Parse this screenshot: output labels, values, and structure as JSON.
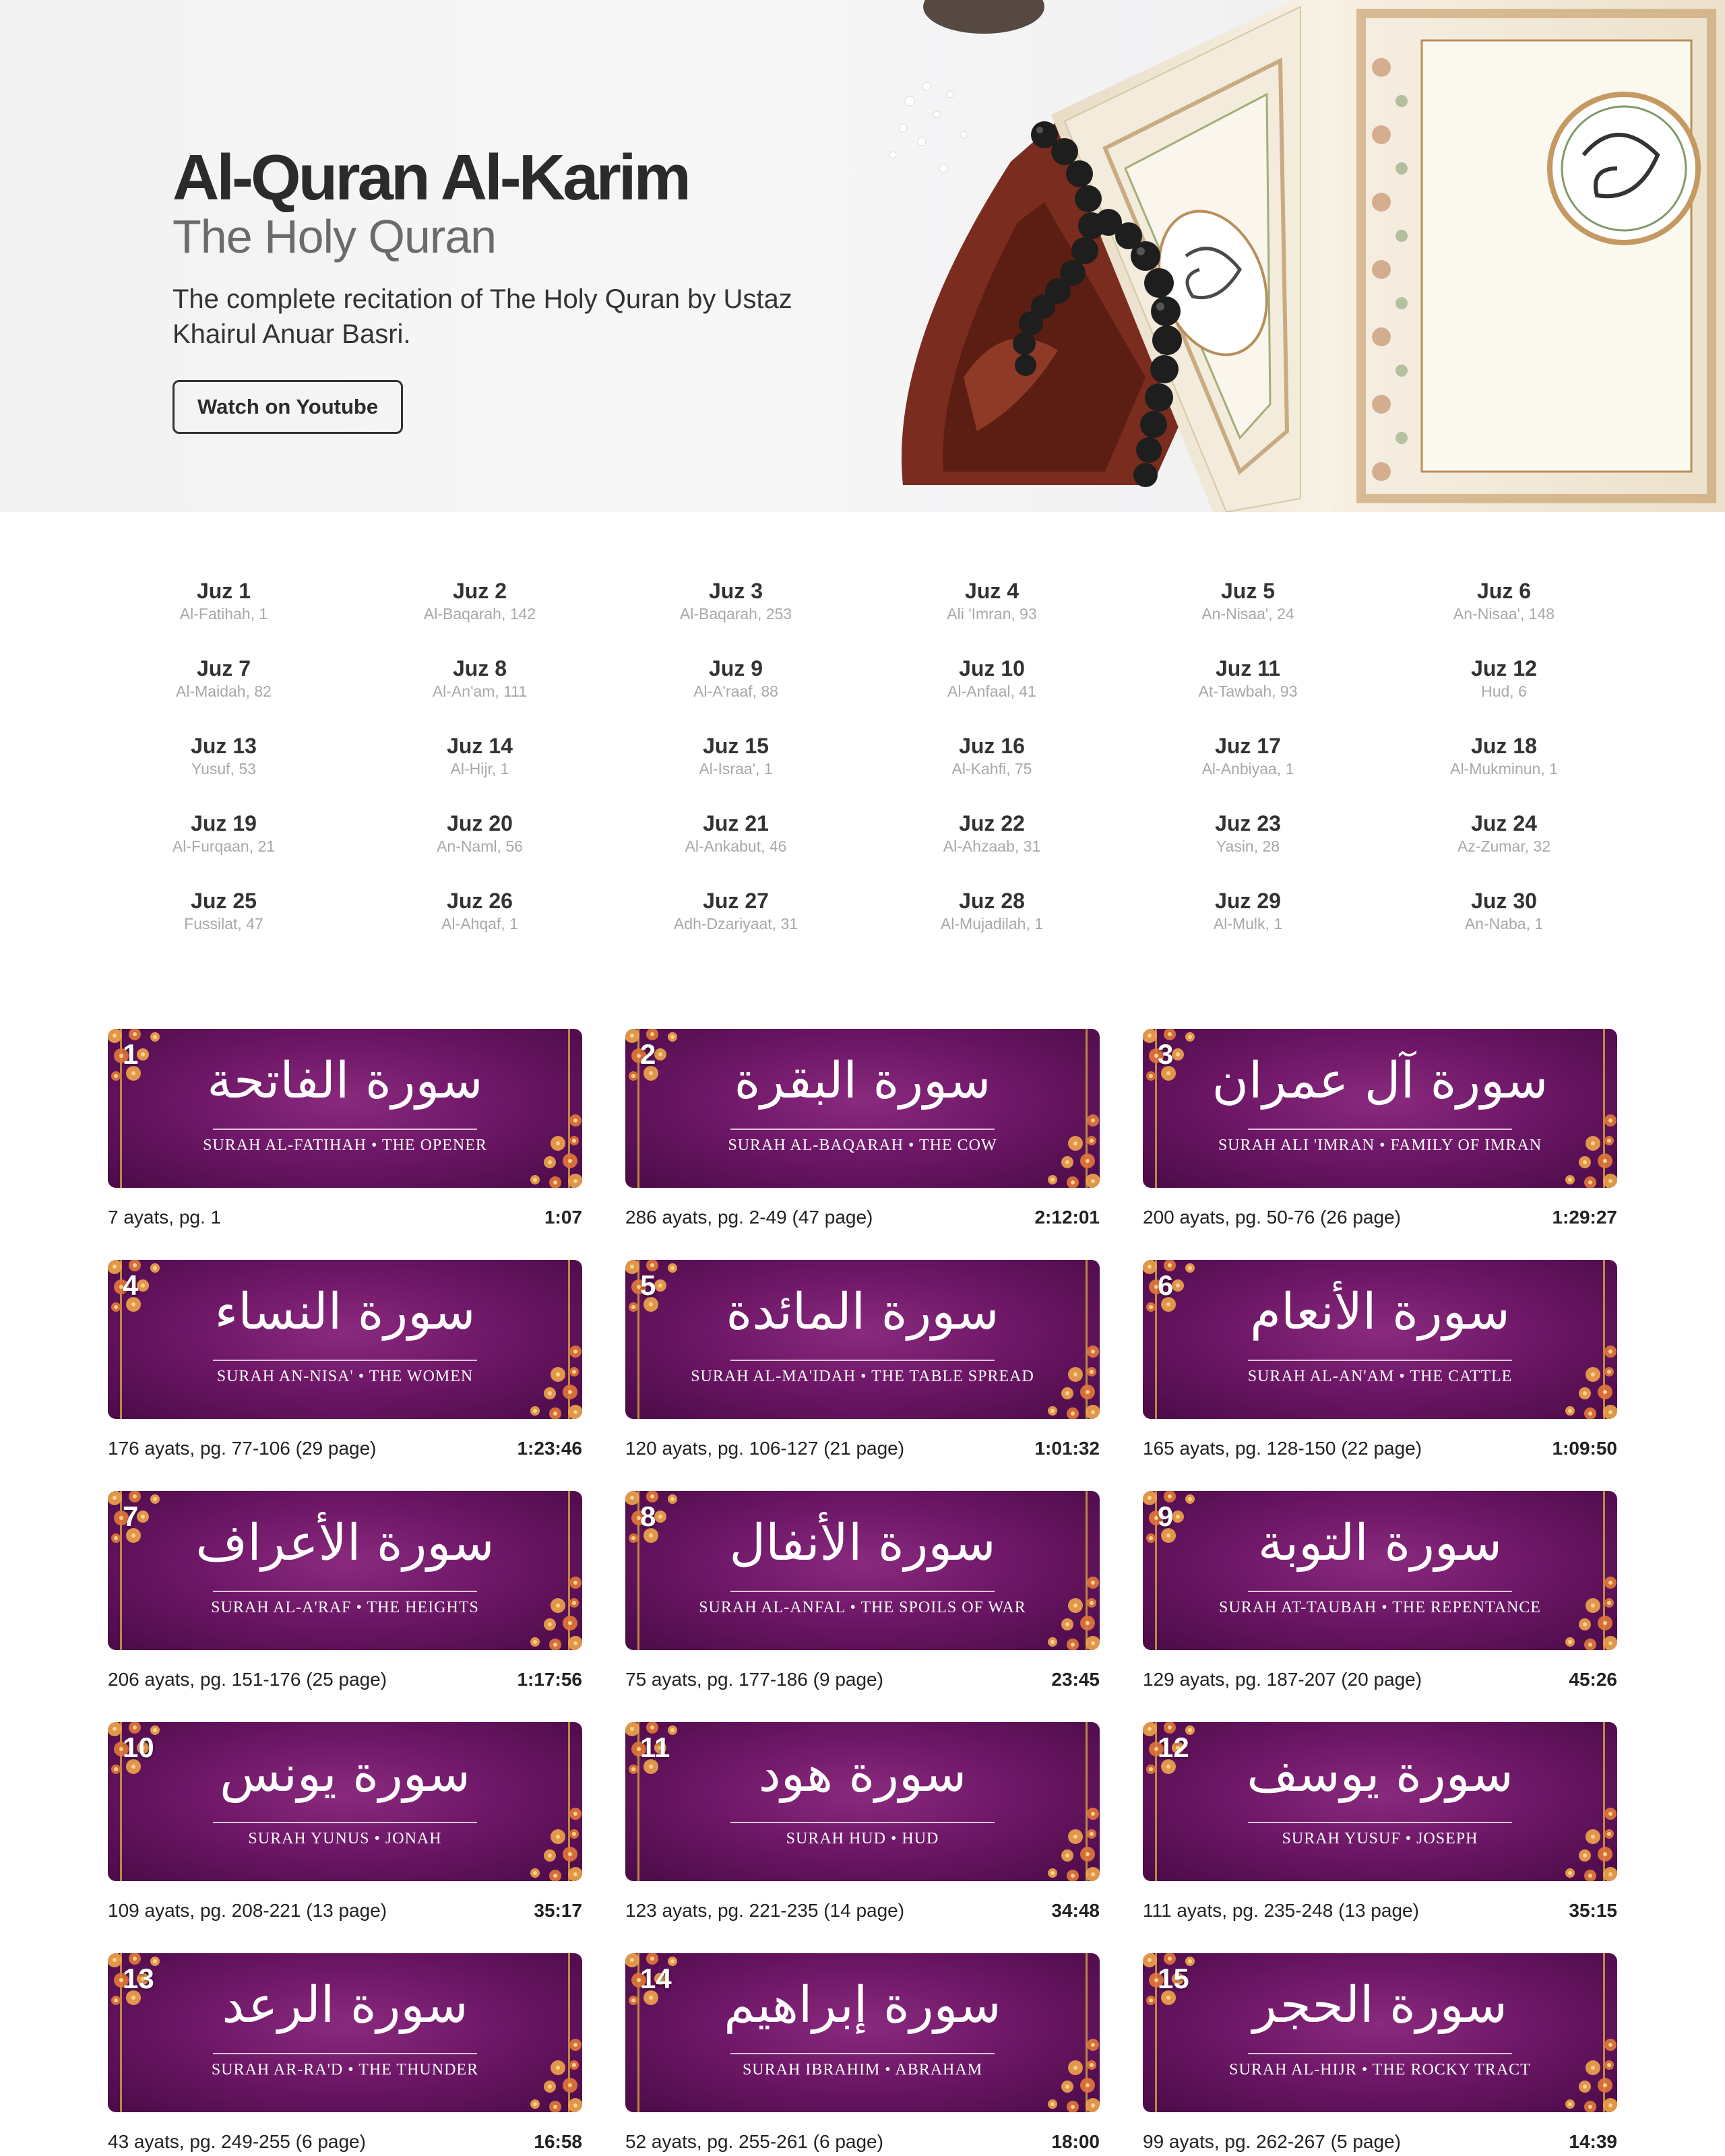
{
  "hero": {
    "title": "Al-Quran Al-Karim",
    "subtitle": "The Holy Quran",
    "description": "The complete recitation of The Holy Quran by Ustaz Khairul Anuar Basri.",
    "button_label": "Watch on Youtube"
  },
  "juz": [
    {
      "title": "Juz 1",
      "start": "Al-Fatihah, 1"
    },
    {
      "title": "Juz 2",
      "start": "Al-Baqarah, 142"
    },
    {
      "title": "Juz 3",
      "start": "Al-Baqarah, 253"
    },
    {
      "title": "Juz 4",
      "start": "Ali 'Imran, 93"
    },
    {
      "title": "Juz 5",
      "start": "An-Nisaa', 24"
    },
    {
      "title": "Juz 6",
      "start": "An-Nisaa', 148"
    },
    {
      "title": "Juz 7",
      "start": "Al-Maidah, 82"
    },
    {
      "title": "Juz 8",
      "start": "Al-An'am, 111"
    },
    {
      "title": "Juz 9",
      "start": "Al-A'raaf, 88"
    },
    {
      "title": "Juz 10",
      "start": "Al-Anfaal, 41"
    },
    {
      "title": "Juz 11",
      "start": "At-Tawbah, 93"
    },
    {
      "title": "Juz 12",
      "start": "Hud, 6"
    },
    {
      "title": "Juz 13",
      "start": "Yusuf, 53"
    },
    {
      "title": "Juz 14",
      "start": "Al-Hijr, 1"
    },
    {
      "title": "Juz 15",
      "start": "Al-Israa', 1"
    },
    {
      "title": "Juz 16",
      "start": "Al-Kahfi, 75"
    },
    {
      "title": "Juz 17",
      "start": "Al-Anbiyaa, 1"
    },
    {
      "title": "Juz 18",
      "start": "Al-Mukminun, 1"
    },
    {
      "title": "Juz 19",
      "start": "Al-Furqaan, 21"
    },
    {
      "title": "Juz 20",
      "start": "An-Naml, 56"
    },
    {
      "title": "Juz 21",
      "start": "Al-Ankabut, 46"
    },
    {
      "title": "Juz 22",
      "start": "Al-Ahzaab, 31"
    },
    {
      "title": "Juz 23",
      "start": "Yasin, 28"
    },
    {
      "title": "Juz 24",
      "start": "Az-Zumar, 32"
    },
    {
      "title": "Juz 25",
      "start": "Fussilat, 47"
    },
    {
      "title": "Juz 26",
      "start": "Al-Ahqaf, 1"
    },
    {
      "title": "Juz 27",
      "start": "Adh-Dzariyaat, 31"
    },
    {
      "title": "Juz 28",
      "start": "Al-Mujadilah, 1"
    },
    {
      "title": "Juz 29",
      "start": "Al-Mulk, 1"
    },
    {
      "title": "Juz 30",
      "start": "An-Naba, 1"
    }
  ],
  "surahs": [
    {
      "number": "1",
      "arabic": "سورة الفاتحة",
      "english": "SURAH AL-FATIHAH • THE OPENER",
      "info": "7 ayats, pg. 1",
      "duration": "1:07"
    },
    {
      "number": "2",
      "arabic": "سورة البقرة",
      "english": "SURAH AL-BAQARAH • THE COW",
      "info": "286 ayats, pg. 2-49 (47 page)",
      "duration": "2:12:01"
    },
    {
      "number": "3",
      "arabic": "سورة آل عمران",
      "english": "SURAH ALI 'IMRAN • FAMILY OF IMRAN",
      "info": "200 ayats, pg. 50-76 (26 page)",
      "duration": "1:29:27"
    },
    {
      "number": "4",
      "arabic": "سورة النساء",
      "english": "SURAH AN-NISA' • THE WOMEN",
      "info": "176 ayats, pg. 77-106 (29 page)",
      "duration": "1:23:46"
    },
    {
      "number": "5",
      "arabic": "سورة المائدة",
      "english": "SURAH AL-MA'IDAH • THE TABLE SPREAD",
      "info": "120 ayats, pg. 106-127 (21 page)",
      "duration": "1:01:32"
    },
    {
      "number": "6",
      "arabic": "سورة الأنعام",
      "english": "SURAH AL-AN'AM • THE CATTLE",
      "info": "165 ayats, pg. 128-150 (22 page)",
      "duration": "1:09:50"
    },
    {
      "number": "7",
      "arabic": "سورة الأعراف",
      "english": "SURAH AL-A'RAF • THE HEIGHTS",
      "info": "206 ayats, pg. 151-176 (25 page)",
      "duration": "1:17:56"
    },
    {
      "number": "8",
      "arabic": "سورة الأنفال",
      "english": "SURAH AL-ANFAL • THE SPOILS OF WAR",
      "info": "75 ayats, pg. 177-186 (9 page)",
      "duration": "23:45"
    },
    {
      "number": "9",
      "arabic": "سورة التوبة",
      "english": "SURAH AT-TAUBAH • THE REPENTANCE",
      "info": "129 ayats, pg. 187-207 (20 page)",
      "duration": "45:26"
    },
    {
      "number": "10",
      "arabic": "سورة يونس",
      "english": "SURAH YUNUS • JONAH",
      "info": "109 ayats, pg. 208-221 (13 page)",
      "duration": "35:17"
    },
    {
      "number": "11",
      "arabic": "سورة هود",
      "english": "SURAH HUD • HUD",
      "info": "123 ayats, pg. 221-235 (14 page)",
      "duration": "34:48"
    },
    {
      "number": "12",
      "arabic": "سورة يوسف",
      "english": "SURAH YUSUF • JOSEPH",
      "info": "111 ayats, pg. 235-248 (13 page)",
      "duration": "35:15"
    },
    {
      "number": "13",
      "arabic": "سورة الرعد",
      "english": "SURAH AR-RA'D • THE THUNDER",
      "info": "43 ayats, pg. 249-255 (6 page)",
      "duration": "16:58"
    },
    {
      "number": "14",
      "arabic": "سورة إبراهيم",
      "english": "SURAH IBRAHIM • ABRAHAM",
      "info": "52 ayats, pg. 255-261 (6 page)",
      "duration": "18:00"
    },
    {
      "number": "15",
      "arabic": "سورة الحجر",
      "english": "SURAH AL-HIJR • THE ROCKY TRACT",
      "info": "99 ayats, pg. 262-267 (5 page)",
      "duration": "14:39"
    }
  ]
}
